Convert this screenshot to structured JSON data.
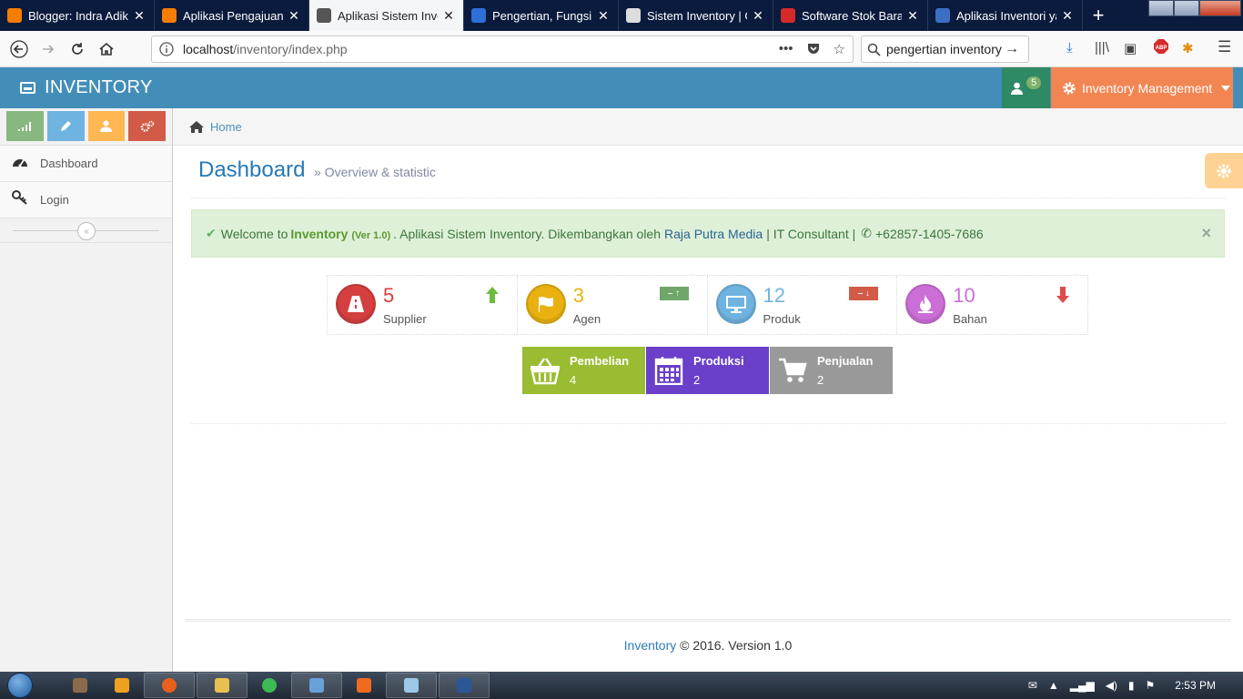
{
  "browser": {
    "tabs": [
      {
        "title": "Blogger: Indra Adikusuma",
        "favicon_color": "#f57d00",
        "active": false
      },
      {
        "title": "Aplikasi Pengajuan Judul",
        "favicon_color": "#f57d00",
        "active": false
      },
      {
        "title": "Aplikasi Sistem Inventory",
        "favicon_color": "#555555",
        "active": true
      },
      {
        "title": "Pengertian, Fungsi dan",
        "favicon_color": "#2e6fd8",
        "active": false
      },
      {
        "title": "Sistem Inventory | Gudang",
        "favicon_color": "#dddddd",
        "active": false
      },
      {
        "title": "Software Stok Barang",
        "favicon_color": "#d42a2a",
        "active": false
      },
      {
        "title": "Aplikasi Inventori yang",
        "favicon_color": "#3a6fc4",
        "active": false
      }
    ],
    "tab_close_glyph": "✕",
    "new_tab_glyph": "+",
    "url_host": "localhost",
    "url_path": "/inventory/index.php",
    "search_value": "pengertian inventory"
  },
  "app": {
    "brand": "INVENTORY",
    "notification_count": "5",
    "management_menu": "Inventory Management",
    "colors": {
      "header": "#438eb9",
      "user_box": "#2e8965",
      "management": "#f28653"
    }
  },
  "sidebar": {
    "shortcuts": [
      {
        "icon": "signal-icon",
        "color": "#87b87f"
      },
      {
        "icon": "pencil-icon",
        "color": "#6fb3e0"
      },
      {
        "icon": "group-icon",
        "color": "#ffb752"
      },
      {
        "icon": "cogs-icon",
        "color": "#d15b47"
      }
    ],
    "items": [
      {
        "label": "Dashboard",
        "icon": "dashboard-icon"
      },
      {
        "label": "Login",
        "icon": "key-icon"
      }
    ]
  },
  "breadcrumb": {
    "home": "Home"
  },
  "page": {
    "title": "Dashboard",
    "subtitle": "» Overview & statistic"
  },
  "alert": {
    "welcome": "Welcome to",
    "brand": "Inventory",
    "version": "(Ver 1.0)",
    "description": ". Aplikasi Sistem Inventory. Dikembangkan oleh",
    "developer": "Raja Putra Media",
    "role": "| IT Consultant |",
    "phone": "+62857-1405-7686"
  },
  "infoboxes": [
    {
      "value": "5",
      "label": "Supplier",
      "color": "#d53f40",
      "icon": "road-icon",
      "trend": "up"
    },
    {
      "value": "3",
      "label": "Agen",
      "color": "#e8b110",
      "icon": "flag-icon",
      "trend": "up-badge"
    },
    {
      "value": "12",
      "label": "Produk",
      "color": "#6fb3e0",
      "icon": "desktop-icon",
      "trend": "down-badge"
    },
    {
      "value": "10",
      "label": "Bahan",
      "color": "#cb6fd7",
      "icon": "flame-icon",
      "trend": "down"
    }
  ],
  "stat_boxes": [
    {
      "title": "Pembelian",
      "value": "4",
      "color": "#9abc32",
      "icon": "basket-icon"
    },
    {
      "title": "Produksi",
      "value": "2",
      "color": "#6a3fc9",
      "icon": "calendar-icon"
    },
    {
      "title": "Penjualan",
      "value": "2",
      "color": "#999999",
      "icon": "cart-icon"
    }
  ],
  "footer": {
    "brand": "Inventory",
    "text": "© 2016. Version 1.0"
  },
  "taskbar": {
    "time": "2:53 PM"
  }
}
